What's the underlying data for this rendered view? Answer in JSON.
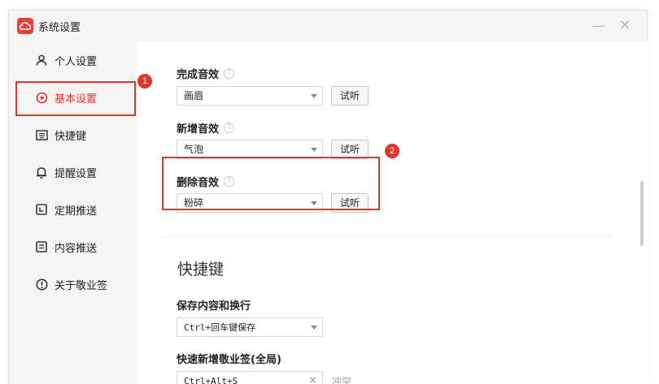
{
  "window": {
    "title": "系统设置",
    "app_icon": "cloud-icon",
    "controls": {
      "minimize": "—",
      "close": "✕"
    }
  },
  "sidebar": {
    "items": [
      {
        "label": "个人设置",
        "icon": "user-icon"
      },
      {
        "label": "基本设置",
        "icon": "target-icon",
        "active": true
      },
      {
        "label": "快捷键",
        "icon": "keyboard-icon"
      },
      {
        "label": "提醒设置",
        "icon": "bell-icon"
      },
      {
        "label": "定期推送",
        "icon": "calendar-icon"
      },
      {
        "label": "内容推送",
        "icon": "document-icon"
      },
      {
        "label": "关于敬业签",
        "icon": "info-icon"
      }
    ]
  },
  "sound": {
    "complete": {
      "label": "完成音效",
      "value": "画眉",
      "test_label": "试听"
    },
    "new": {
      "label": "新增音效",
      "value": "气泡",
      "test_label": "试听"
    },
    "delete": {
      "label": "删除音效",
      "value": "粉碎",
      "test_label": "试听"
    },
    "help_glyph": "?"
  },
  "shortcuts": {
    "section_title": "快捷键",
    "save": {
      "label": "保存内容和换行",
      "value": "Ctrl+回车键保存"
    },
    "quick_add": {
      "label": "快速新增敬业签(全局)",
      "value": "Ctrl+Alt+S",
      "clear": "×",
      "status": "冲突"
    }
  },
  "annotations": {
    "badge_1": "1",
    "badge_2": "2",
    "highlight_color": "#e0352b"
  }
}
